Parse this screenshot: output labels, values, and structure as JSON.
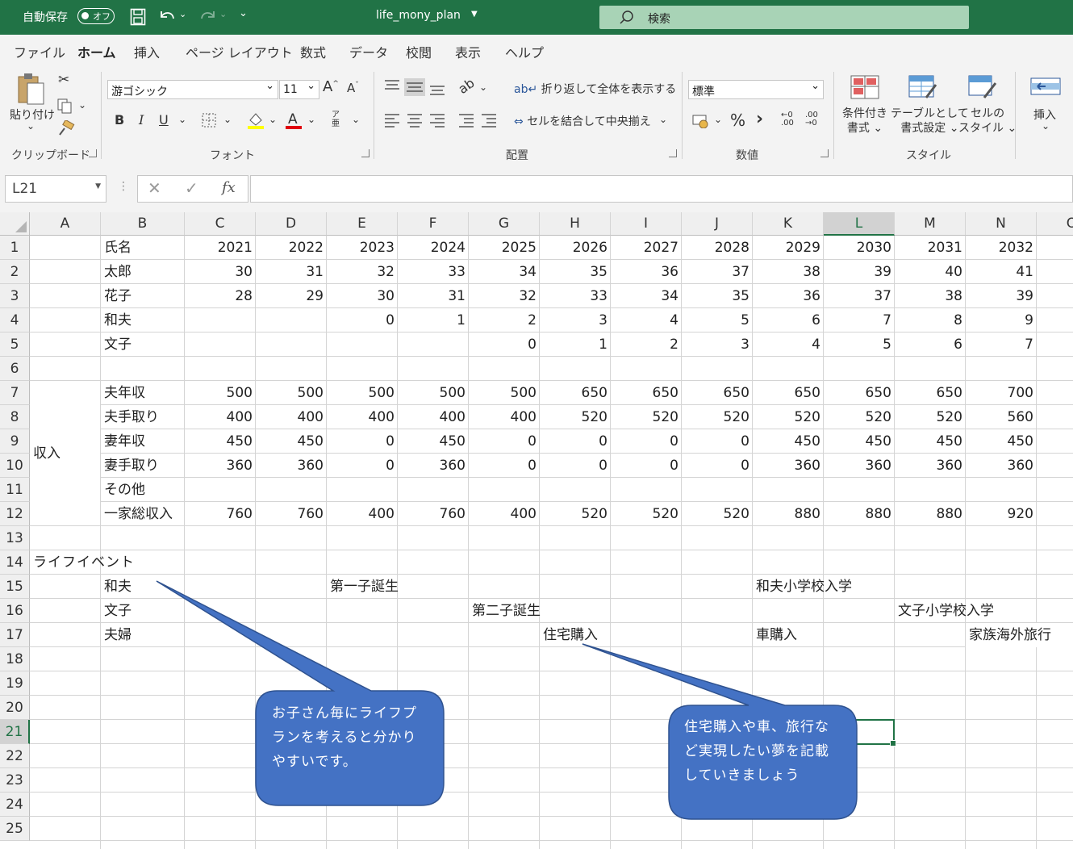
{
  "titlebar": {
    "autosave_label": "自動保存",
    "autosave_state": "オフ",
    "filename": "life_mony_plan",
    "search_placeholder": "検索"
  },
  "menu_tabs": [
    "ファイル",
    "ホーム",
    "挿入",
    "ページ レイアウト",
    "数式",
    "データ",
    "校閲",
    "表示",
    "ヘルプ"
  ],
  "ribbon": {
    "clipboard": {
      "paste": "貼り付け",
      "group": "クリップボード"
    },
    "font": {
      "name": "游ゴシック",
      "size": "11",
      "group": "フォント"
    },
    "alignment": {
      "wrap": "折り返して全体を表示する",
      "merge": "セルを結合して中央揃え",
      "group": "配置"
    },
    "number": {
      "format": "標準",
      "group": "数値"
    },
    "styles": {
      "conditional": [
        "条件付き",
        "書式"
      ],
      "table": [
        "テーブルとして",
        "書式設定"
      ],
      "cell": [
        "セルの",
        "スタイル"
      ],
      "group": "スタイル"
    },
    "cells": {
      "insert": "挿入"
    }
  },
  "formula_bar": {
    "name_box": "L21",
    "formula": ""
  },
  "columns": [
    "A",
    "B",
    "C",
    "D",
    "E",
    "F",
    "G",
    "H",
    "I",
    "J",
    "K",
    "L",
    "M",
    "N",
    "O"
  ],
  "selected_column": "L",
  "selected_row": "21",
  "rows": [
    "1",
    "2",
    "3",
    "4",
    "5",
    "6",
    "7",
    "8",
    "9",
    "10",
    "11",
    "12",
    "13",
    "14",
    "15",
    "16",
    "17",
    "18",
    "19",
    "20",
    "21",
    "22",
    "23",
    "24",
    "25"
  ],
  "sheet": {
    "r1": [
      "氏名",
      "2021",
      "2022",
      "2023",
      "2024",
      "2025",
      "2026",
      "2027",
      "2028",
      "2029",
      "2030",
      "2031",
      "2032"
    ],
    "r2": [
      "太郎",
      "30",
      "31",
      "32",
      "33",
      "34",
      "35",
      "36",
      "37",
      "38",
      "39",
      "40",
      "41"
    ],
    "r3": [
      "花子",
      "28",
      "29",
      "30",
      "31",
      "32",
      "33",
      "34",
      "35",
      "36",
      "37",
      "38",
      "39"
    ],
    "r4": [
      "和夫",
      "",
      "",
      "0",
      "1",
      "2",
      "3",
      "4",
      "5",
      "6",
      "7",
      "8",
      "9"
    ],
    "r5": [
      "文子",
      "",
      "",
      "",
      "",
      "0",
      "1",
      "2",
      "3",
      "4",
      "5",
      "6",
      "7"
    ],
    "r7": [
      "夫年収",
      "500",
      "500",
      "500",
      "500",
      "500",
      "650",
      "650",
      "650",
      "650",
      "650",
      "650",
      "700"
    ],
    "r8": [
      "夫手取り",
      "400",
      "400",
      "400",
      "400",
      "400",
      "520",
      "520",
      "520",
      "520",
      "520",
      "520",
      "560"
    ],
    "r9": [
      "妻年収",
      "450",
      "450",
      "0",
      "450",
      "0",
      "0",
      "0",
      "0",
      "450",
      "450",
      "450",
      "450"
    ],
    "r10": [
      "妻手取り",
      "360",
      "360",
      "0",
      "360",
      "0",
      "0",
      "0",
      "0",
      "360",
      "360",
      "360",
      "360"
    ],
    "r11": [
      "その他",
      "",
      "",
      "",
      "",
      "",
      "",
      "",
      "",
      "",
      "",
      "",
      ""
    ],
    "r12": [
      "一家総収入",
      "760",
      "760",
      "400",
      "760",
      "400",
      "520",
      "520",
      "520",
      "880",
      "880",
      "880",
      "920"
    ],
    "income_label": "収入",
    "life_event_label": "ライフイベント",
    "r15_label": "和夫",
    "r16_label": "文子",
    "r17_label": "夫婦",
    "events": {
      "e15": "第一子誕生",
      "k15": "和夫小学校入学",
      "g16": "第二子誕生",
      "m16": "文子小学校入学",
      "h17": "住宅購入",
      "k17": "車購入",
      "n17": "家族海外旅行"
    }
  },
  "callouts": {
    "left": [
      "お子さん毎にライフプ",
      "ランを考えると分かり",
      "やすいです。"
    ],
    "right": [
      "住宅購入や車、旅行な",
      "ど実現したい夢を記載",
      "していきましょう"
    ]
  },
  "colors": {
    "excel_green": "#217346",
    "callout_fill": "#4472c4",
    "callout_stroke": "#2f528f"
  }
}
